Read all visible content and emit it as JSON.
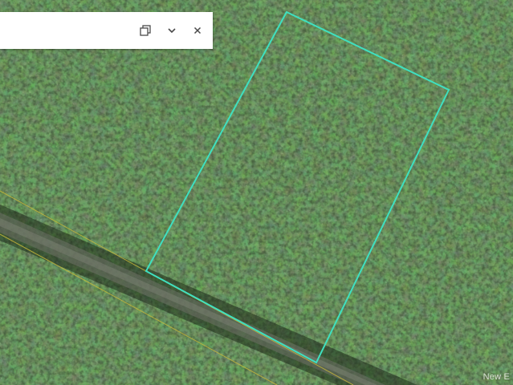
{
  "popup": {
    "title": "",
    "dock_icon": "dock-icon",
    "collapse_icon": "chevron-down-icon",
    "close_icon": "close-icon"
  },
  "map": {
    "type": "satellite-imagery",
    "parcel_color": "#3fe0c0",
    "road_line_color": "#c8b83a"
  },
  "watermark": {
    "text": "New E"
  }
}
